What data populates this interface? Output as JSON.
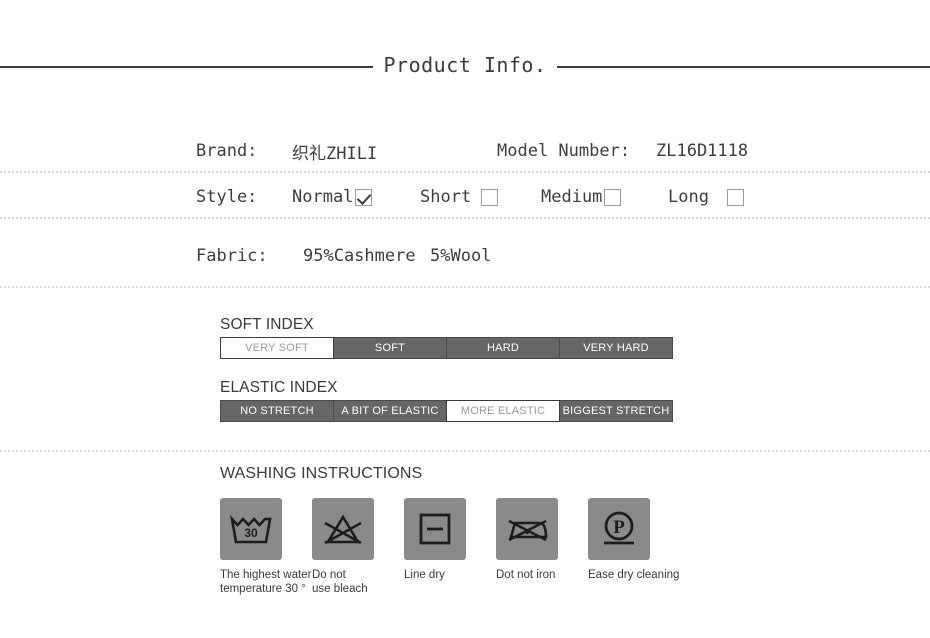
{
  "header": {
    "title": "Product Info."
  },
  "spec": {
    "brand_label": "Brand:",
    "brand_value": "织礼ZHILI",
    "model_label": "Model Number:",
    "model_value": "ZL16D1118",
    "style_label": "Style:",
    "style_options": [
      {
        "label": "Normal",
        "checked": true
      },
      {
        "label": "Short",
        "checked": false
      },
      {
        "label": "Medium",
        "checked": false
      },
      {
        "label": "Long",
        "checked": false
      }
    ],
    "fabric_label": "Fabric:",
    "fabric_value_1": "95%Cashmere",
    "fabric_value_2": "5%Wool"
  },
  "soft_index": {
    "title": "SOFT INDEX",
    "cells": [
      {
        "label": "VERY SOFT",
        "active": true
      },
      {
        "label": "SOFT",
        "active": false
      },
      {
        "label": "HARD",
        "active": false
      },
      {
        "label": "VERY HARD",
        "active": false
      }
    ]
  },
  "elastic_index": {
    "title": "ELASTIC INDEX",
    "cells": [
      {
        "label": "NO STRETCH",
        "active": false
      },
      {
        "label": "A BIT OF ELASTIC",
        "active": false
      },
      {
        "label": "MORE ELASTIC",
        "active": true
      },
      {
        "label": "BIGGEST STRETCH",
        "active": false
      }
    ]
  },
  "washing": {
    "title": "WASHING INSTRUCTIONS",
    "items": [
      {
        "icon": "wash-tub-30-icon",
        "temperature": "30",
        "caption": "The highest water\ntemperature 30 °"
      },
      {
        "icon": "do-not-bleach-icon",
        "caption": "Do not\nuse bleach"
      },
      {
        "icon": "line-dry-icon",
        "caption": "Line dry"
      },
      {
        "icon": "do-not-iron-icon",
        "caption": "Dot not iron"
      },
      {
        "icon": "dry-clean-p-icon",
        "caption": "Ease dry cleaning"
      }
    ]
  },
  "colors": {
    "bar_grey": "#666666",
    "icon_box_grey": "#8a8a8a",
    "rule_dark": "#3b3b3b",
    "dotted_grey": "#d9d9d9",
    "text": "#3a3a3a"
  }
}
